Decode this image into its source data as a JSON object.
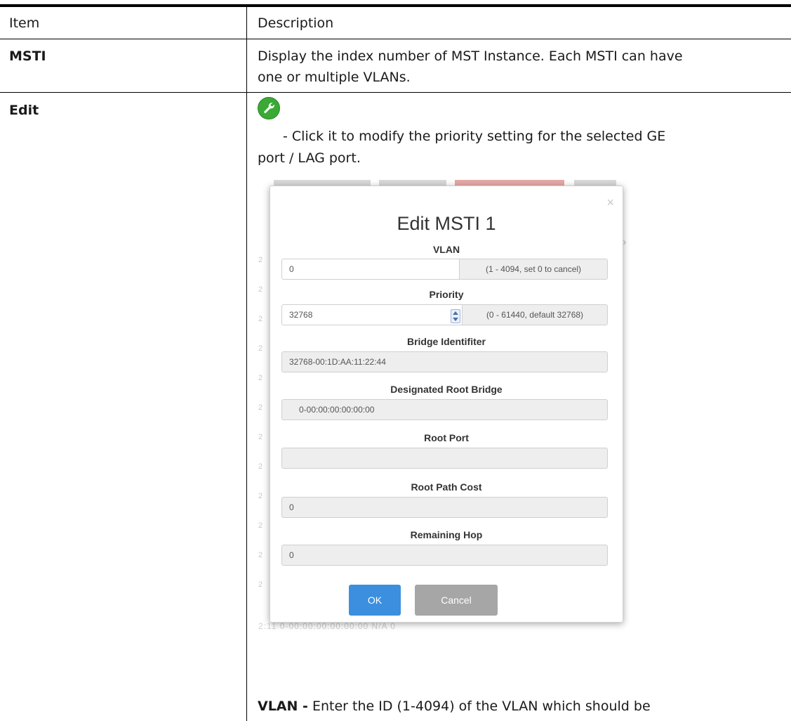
{
  "table": {
    "header": {
      "item": "Item",
      "description": "Description"
    },
    "rows": [
      {
        "item": "MSTI",
        "description_line1": "Display the index number of MST Instance. Each MSTI can have",
        "description_line2": "one or multiple VLANs."
      },
      {
        "item": "Edit",
        "icon": "wrench-icon",
        "description_line1": "- Click it to modify the priority setting for the selected GE",
        "description_line2": "port / LAG port."
      }
    ],
    "footer_label": "VLAN -",
    "footer_text": "Enter the ID (1-4094) of the VLAN which should be"
  },
  "modal": {
    "title": "Edit MSTI 1",
    "close_glyph": "×",
    "vlan": {
      "label": "VLAN",
      "value": "0",
      "hint": "(1 - 4094, set 0 to cancel)"
    },
    "priority": {
      "label": "Priority",
      "value": "32768",
      "hint": "(0 - 61440, default 32768)"
    },
    "bridge_identifier": {
      "label": "Bridge Identifiter",
      "value": "32768-00:1D:AA:11:22:44"
    },
    "designated_root_bridge": {
      "label": "Designated Root Bridge",
      "value": "0-00:00:00:00:00:00"
    },
    "root_port": {
      "label": "Root Port",
      "value": ""
    },
    "root_path_cost": {
      "label": "Root Path Cost",
      "value": "0"
    },
    "remaining_hop": {
      "label": "Remaining Hop",
      "value": "0"
    },
    "ok_label": "OK",
    "cancel_label": "Cancel"
  },
  "background": {
    "row_prefix": "2",
    "side_letter": "P",
    "bottom_row": "2:11      0-00:00:00:00:00:00          N/A               0"
  },
  "colors": {
    "ok_button": "#3c8fde",
    "cancel_button": "#a6a6a6",
    "icon_green": "#3aa935"
  }
}
